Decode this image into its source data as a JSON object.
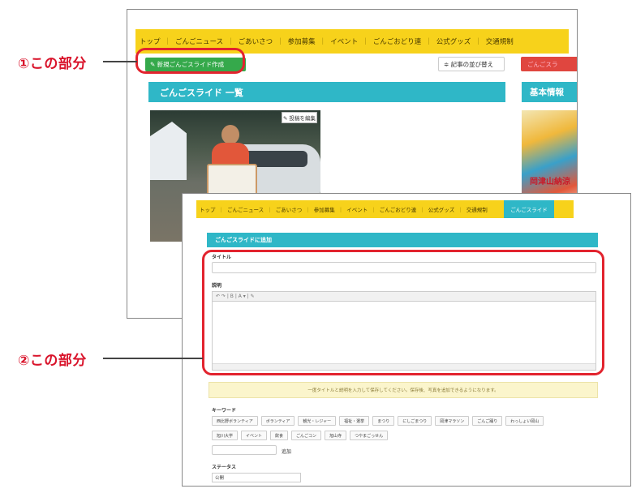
{
  "callouts": {
    "first": "①この部分",
    "second": "②この部分"
  },
  "nav_back": [
    "トップ",
    "ごんごニュース",
    "ごあいさつ",
    "参加募集",
    "イベント",
    "ごんごおどり連",
    "公式グッズ",
    "交通規制"
  ],
  "nav_sep": "｜",
  "back": {
    "new_button": "✎ 新規ごんごスライド作成",
    "sort_button": "≑ 記事の並び替え",
    "red_button": "ごんごスラ",
    "list_title": "ごんごスライド 一覧",
    "side_title": "基本情報",
    "edit_chip": "✎ 投稿を編集",
    "side_caption": "岡津山納涼"
  },
  "front": {
    "nav": [
      "トップ",
      "ごんごニュース",
      "ごあいさつ",
      "参加募集",
      "イベント",
      "ごんごおどり連",
      "公式グッズ",
      "交通規制"
    ],
    "nav_active": "ごんごスライド",
    "panel_title": "ごんごスライドに追加",
    "title_label": "タイトル",
    "desc_label": "説明",
    "toolbar": "↶  ↷  |  B  |  A ▾  |  ✎",
    "notice": "一度タイトルと説明を入力して保存してください。保存後、写真を追加できるようになります。",
    "keyword_label": "キーワード",
    "tags_row1": [
      "西比野ボランティア",
      "ボランティア",
      "観光・レジャー",
      "福祉・選挙",
      "まつり",
      "にしごまつり",
      "岡津マラソン",
      "ごんご踊り",
      "わっしょい岡山"
    ],
    "tags_row2": [
      "旭川大学",
      "イベント",
      "飲食",
      "ごんごコン",
      "旭山寺",
      "つやまごっせん"
    ],
    "add_button": "追加",
    "status_label": "ステータス",
    "status_value": "公開"
  }
}
